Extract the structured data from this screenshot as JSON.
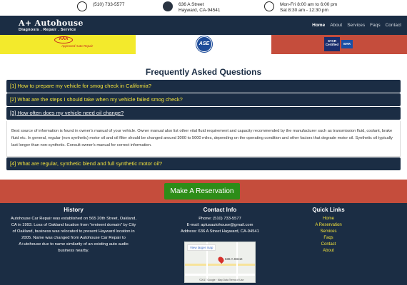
{
  "topbar": {
    "phone": "(510) 733-5577",
    "address_line1": "636 A Street",
    "address_line2": "Hayward, CA-94541",
    "hours_line1": "Mon-Fri 8:00 am to 6:00 pm",
    "hours_line2": "Sat 8:30 am - 12:30 pm"
  },
  "nav": {
    "logo_main": "A+ Autohouse",
    "logo_sub": "Diagnosis . Repair . Service",
    "links": [
      "Home",
      "About",
      "Services",
      "Faqs",
      "Contact"
    ]
  },
  "badges": {
    "aaa": "AAA",
    "aaa_caption": "Approved Auto Repair",
    "ase": "ASE",
    "star": "STAR Certified",
    "bar": "BAR"
  },
  "faq": {
    "title": "Frequently Asked Questions",
    "questions": [
      "[1] How to prepare my vehicle for smog check in California?",
      "[2] What are the steps I should take when my vehicle failed smog check?",
      "[3] How often does my vehicle need oil change?",
      "[4] What are regular, synthetic blend and full synthetic motor oil?"
    ],
    "open_answer": "Best source of information is found in owner's manual of your vehicle. Owner manual also list other vital fluid requirement and capacity recommended by the manufacturer such as transmission fluid, coolant, brake fluid etc. In general, regular (non synthetic) motor oil and oil filter should be changed around 3000 to 5000 miles, depending on the operating condition and other factors that degrade motor oil. Synthetic oil typically last longer than non-synthetic. Consult owner's manual for correct information."
  },
  "reservation": {
    "button": "Make A Reservation"
  },
  "footer": {
    "history_title": "History",
    "history_text": "Autohouse Car Repair was established on 565 20th Street, Oakland, CA in 1993. Loss of Oakland location from \"eminent domain\" by City of Oakland, business was relocated to present Hayward location in 2005. Name was changed from Autohouse Car Repair to A+utohouse due to name similarity of an existing auto audio business nearby.",
    "contact_title": "Contact Info",
    "contact_phone": "Phone: (510) 733-5577",
    "contact_email": "E-mail: aplusautohouse@gmail.com",
    "contact_address": "Address: 636 A Street Hayward, CA-94541",
    "map_link": "View larger map",
    "map_label": "636 A Street",
    "map_footer": "©2017 Google · Map Data   Terms of Use",
    "links_title": "Quick Links",
    "links": [
      "Home",
      "A Reservation",
      "Services",
      "Faqs",
      "Contact",
      "About"
    ]
  },
  "colors": {
    "navy": "#1b2d44",
    "yellow_text": "#f4e33b",
    "red_band": "#c54d3c",
    "green_button": "#2d8d18",
    "yellow_badge": "#f3ea2c"
  }
}
